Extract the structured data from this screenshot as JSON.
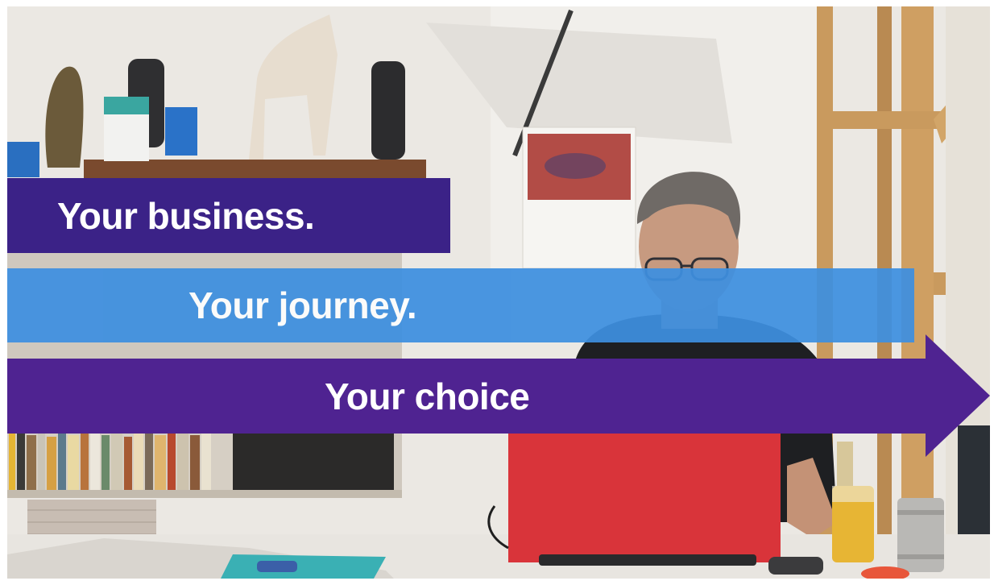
{
  "banners": {
    "business": "Your business.",
    "journey": "Your journey.",
    "choice": "Your choice"
  },
  "colors": {
    "banner_dark": "#3b2287",
    "banner_blue": "#3d8fe0",
    "banner_arrow": "#4f2391",
    "laptop": "#d9343a"
  }
}
